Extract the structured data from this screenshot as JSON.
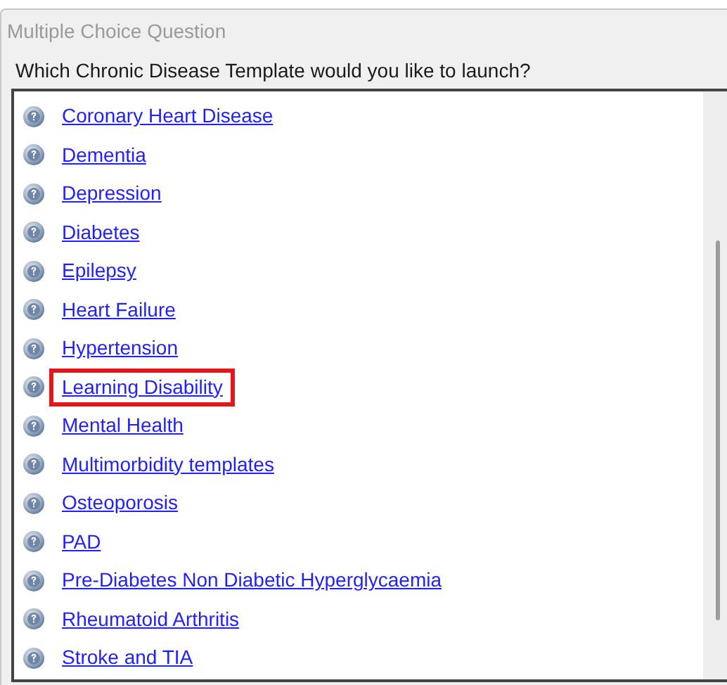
{
  "window": {
    "title": "Multiple Choice Question"
  },
  "question": "Which Chronic Disease Template would you like to launch?",
  "options": [
    {
      "label": "Coronary Heart Disease",
      "highlighted": false
    },
    {
      "label": "Dementia",
      "highlighted": false
    },
    {
      "label": "Depression",
      "highlighted": false
    },
    {
      "label": "Diabetes",
      "highlighted": false
    },
    {
      "label": "Epilepsy",
      "highlighted": false
    },
    {
      "label": "Heart Failure",
      "highlighted": false
    },
    {
      "label": "Hypertension",
      "highlighted": false
    },
    {
      "label": "Learning Disability",
      "highlighted": true
    },
    {
      "label": "Mental Health",
      "highlighted": false
    },
    {
      "label": "Multimorbidity templates",
      "highlighted": false
    },
    {
      "label": "Osteoporosis",
      "highlighted": false
    },
    {
      "label": "PAD",
      "highlighted": false
    },
    {
      "label": "Pre-Diabetes Non Diabetic Hyperglycaemia",
      "highlighted": false
    },
    {
      "label": "Rheumatoid Arthritis",
      "highlighted": false
    },
    {
      "label": "Stroke and TIA",
      "highlighted": false
    }
  ]
}
